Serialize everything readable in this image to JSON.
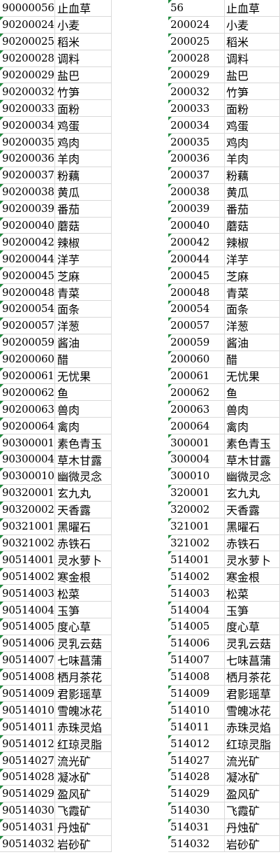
{
  "left_table": {
    "rows": [
      {
        "code": "90000056",
        "name": "止血草"
      },
      {
        "code": "90200024",
        "name": "小麦"
      },
      {
        "code": "90200025",
        "name": "稻米"
      },
      {
        "code": "90200028",
        "name": "调料"
      },
      {
        "code": "90200029",
        "name": "盐巴"
      },
      {
        "code": "90200032",
        "name": "竹笋"
      },
      {
        "code": "90200033",
        "name": "面粉"
      },
      {
        "code": "90200034",
        "name": "鸡蛋"
      },
      {
        "code": "90200035",
        "name": "鸡肉"
      },
      {
        "code": "90200036",
        "name": "羊肉"
      },
      {
        "code": "90200037",
        "name": "粉藕"
      },
      {
        "code": "90200038",
        "name": "黄瓜"
      },
      {
        "code": "90200039",
        "name": "番茄"
      },
      {
        "code": "90200040",
        "name": "蘑菇"
      },
      {
        "code": "90200042",
        "name": "辣椒"
      },
      {
        "code": "90200044",
        "name": "洋芋"
      },
      {
        "code": "90200045",
        "name": "芝麻"
      },
      {
        "code": "90200048",
        "name": "青菜"
      },
      {
        "code": "90200054",
        "name": "面条"
      },
      {
        "code": "90200057",
        "name": "洋葱"
      },
      {
        "code": "90200059",
        "name": "酱油"
      },
      {
        "code": "90200060",
        "name": "醋"
      },
      {
        "code": "90200061",
        "name": "无忧果"
      },
      {
        "code": "90200062",
        "name": "鱼"
      },
      {
        "code": "90200063",
        "name": "兽肉"
      },
      {
        "code": "90200064",
        "name": "禽肉"
      },
      {
        "code": "90300001",
        "name": "素色青玉"
      },
      {
        "code": "90300004",
        "name": "草木甘露"
      },
      {
        "code": "90300010",
        "name": "幽微灵念"
      },
      {
        "code": "90320001",
        "name": "玄九丸"
      },
      {
        "code": "90320002",
        "name": "天香露"
      },
      {
        "code": "90321001",
        "name": "黑曜石"
      },
      {
        "code": "90321002",
        "name": "赤铁石"
      },
      {
        "code": "90514001",
        "name": "灵水萝卜"
      },
      {
        "code": "90514002",
        "name": "寒金根"
      },
      {
        "code": "90514003",
        "name": "松菜"
      },
      {
        "code": "90514004",
        "name": "玉笋"
      },
      {
        "code": "90514005",
        "name": "度心草"
      },
      {
        "code": "90514006",
        "name": "灵乳云菇"
      },
      {
        "code": "90514007",
        "name": "七味菖蒲"
      },
      {
        "code": "90514008",
        "name": "栖月茶花"
      },
      {
        "code": "90514009",
        "name": "君影瑶草"
      },
      {
        "code": "90514010",
        "name": "雪魄冰花"
      },
      {
        "code": "90514011",
        "name": "赤珠灵焰"
      },
      {
        "code": "90514012",
        "name": "红琼灵脂"
      },
      {
        "code": "90514027",
        "name": "流光矿"
      },
      {
        "code": "90514028",
        "name": "凝冰矿"
      },
      {
        "code": "90514029",
        "name": "盈风矿"
      },
      {
        "code": "90514030",
        "name": "飞霞矿"
      },
      {
        "code": "90514031",
        "name": "丹烛矿"
      },
      {
        "code": "90514032",
        "name": "岩砂矿"
      }
    ]
  },
  "right_table": {
    "rows": [
      {
        "code": "56",
        "name": "止血草"
      },
      {
        "code": "200024",
        "name": "小麦"
      },
      {
        "code": "200025",
        "name": "稻米"
      },
      {
        "code": "200028",
        "name": "调料"
      },
      {
        "code": "200029",
        "name": "盐巴"
      },
      {
        "code": "200032",
        "name": "竹笋"
      },
      {
        "code": "200033",
        "name": "面粉"
      },
      {
        "code": "200034",
        "name": "鸡蛋"
      },
      {
        "code": "200035",
        "name": "鸡肉"
      },
      {
        "code": "200036",
        "name": "羊肉"
      },
      {
        "code": "200037",
        "name": "粉藕"
      },
      {
        "code": "200038",
        "name": "黄瓜"
      },
      {
        "code": "200039",
        "name": "番茄"
      },
      {
        "code": "200040",
        "name": "蘑菇"
      },
      {
        "code": "200042",
        "name": "辣椒"
      },
      {
        "code": "200044",
        "name": "洋芋"
      },
      {
        "code": "200045",
        "name": "芝麻"
      },
      {
        "code": "200048",
        "name": "青菜"
      },
      {
        "code": "200054",
        "name": "面条"
      },
      {
        "code": "200057",
        "name": "洋葱"
      },
      {
        "code": "200059",
        "name": "酱油"
      },
      {
        "code": "200060",
        "name": "醋"
      },
      {
        "code": "200061",
        "name": "无忧果"
      },
      {
        "code": "200062",
        "name": "鱼"
      },
      {
        "code": "200063",
        "name": "兽肉"
      },
      {
        "code": "200064",
        "name": "禽肉"
      },
      {
        "code": "300001",
        "name": "素色青玉"
      },
      {
        "code": "300004",
        "name": "草木甘露"
      },
      {
        "code": "300010",
        "name": "幽微灵念"
      },
      {
        "code": "320001",
        "name": "玄九丸"
      },
      {
        "code": "320002",
        "name": "天香露"
      },
      {
        "code": "321001",
        "name": "黑曜石"
      },
      {
        "code": "321002",
        "name": "赤铁石"
      },
      {
        "code": "514001",
        "name": "灵水萝卜"
      },
      {
        "code": "514002",
        "name": "寒金根"
      },
      {
        "code": "514003",
        "name": "松菜"
      },
      {
        "code": "514004",
        "name": "玉笋"
      },
      {
        "code": "514005",
        "name": "度心草"
      },
      {
        "code": "514006",
        "name": "灵乳云菇"
      },
      {
        "code": "514007",
        "name": "七味菖蒲"
      },
      {
        "code": "514008",
        "name": "栖月茶花"
      },
      {
        "code": "514009",
        "name": "君影瑶草"
      },
      {
        "code": "514010",
        "name": "雪魄冰花"
      },
      {
        "code": "514011",
        "name": "赤珠灵焰"
      },
      {
        "code": "514012",
        "name": "红琼灵脂"
      },
      {
        "code": "514027",
        "name": "流光矿"
      },
      {
        "code": "514028",
        "name": "凝冰矿"
      },
      {
        "code": "514029",
        "name": "盈风矿"
      },
      {
        "code": "514030",
        "name": "飞霞矿"
      },
      {
        "code": "514031",
        "name": "丹烛矿"
      },
      {
        "code": "514032",
        "name": "岩砂矿"
      }
    ]
  },
  "colors": {
    "grid": "#d9d9d9",
    "text_marker": "#1e8a3c",
    "background": "#ffffff",
    "text": "#000000"
  },
  "icons": {
    "text_format_marker": "number-stored-as-text-indicator"
  }
}
